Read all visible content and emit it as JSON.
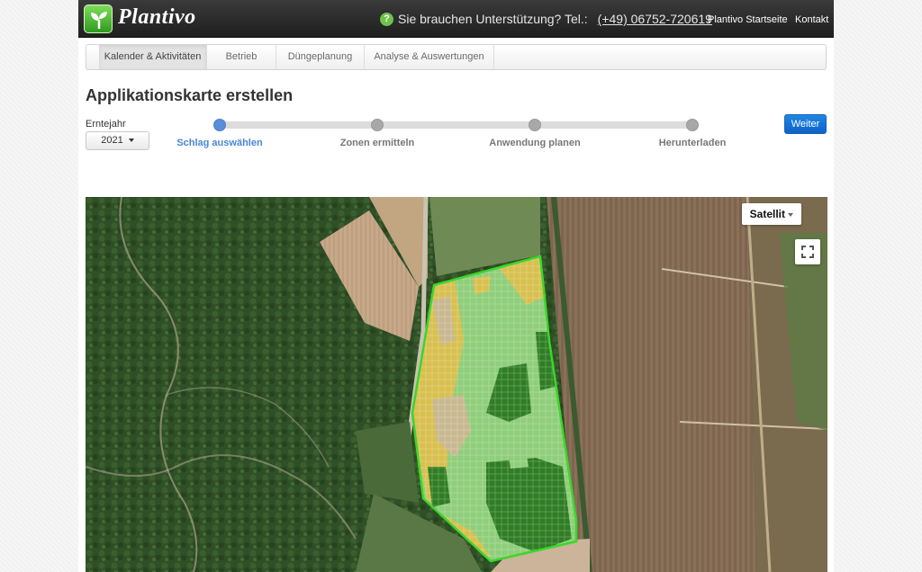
{
  "app": {
    "logo_text": "Plantivo",
    "support_text": "Sie brauchen Unterstützung? Tel.:",
    "support_phone": "(+49) 06752-720619",
    "nav_links": [
      "Plantivo Startseite",
      "Kontakt"
    ]
  },
  "tabs": [
    {
      "label": "Kalender & Aktivitäten",
      "active": true
    },
    {
      "label": "Betrieb",
      "active": false
    },
    {
      "label": "Düngeplanung",
      "active": false
    },
    {
      "label": "Analyse & Auswertungen",
      "active": false
    }
  ],
  "page": {
    "title": "Applikationskarte erstellen",
    "year_label": "Erntejahr",
    "year_value": "2021",
    "next_button": "Weiter"
  },
  "steps": [
    {
      "label": "Schlag auswählen",
      "active": true
    },
    {
      "label": "Zonen ermitteln",
      "active": false
    },
    {
      "label": "Anwendung planen",
      "active": false
    },
    {
      "label": "Herunterladen",
      "active": false
    }
  ],
  "map": {
    "map_type": "Satellit",
    "zone_colors": {
      "low": "#d8c050",
      "bare": "#c8b890",
      "medium": "#8fce7a",
      "high": "#2f7d24",
      "boundary": "#3bd62b"
    }
  },
  "colors": {
    "accent": "#0d62c8",
    "step_active": "#4a86d6"
  }
}
